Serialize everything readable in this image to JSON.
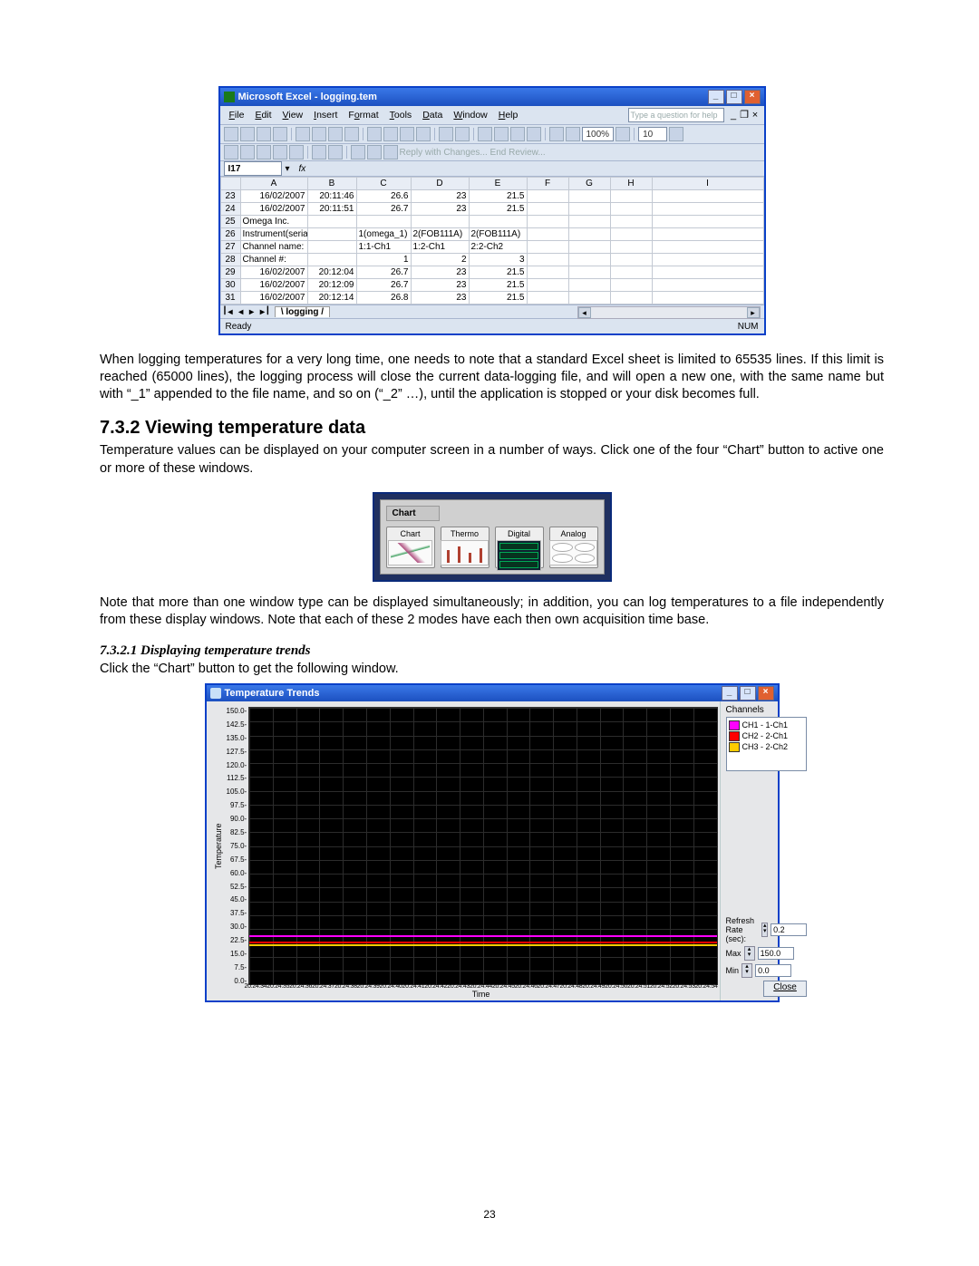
{
  "excel": {
    "title": "Microsoft Excel - logging.tem",
    "menus": [
      "File",
      "Edit",
      "View",
      "Insert",
      "Format",
      "Tools",
      "Data",
      "Window",
      "Help"
    ],
    "question_placeholder": "Type a question for help",
    "zoom": "100%",
    "font_size": "10",
    "toolbar2_text": "Reply with Changes...  End Review...",
    "namebox": "I17",
    "fx": "fx",
    "cols": [
      "A",
      "B",
      "C",
      "D",
      "E",
      "F",
      "G",
      "H",
      "I"
    ],
    "rows": [
      {
        "n": "23",
        "cells": [
          "16/02/2007",
          "20:11:46",
          "26.6",
          "23",
          "21.5",
          "",
          "",
          "",
          ""
        ],
        "align": [
          "r",
          "r",
          "r",
          "r",
          "r",
          "",
          "",
          "",
          ""
        ]
      },
      {
        "n": "24",
        "cells": [
          "16/02/2007",
          "20:11:51",
          "26.7",
          "23",
          "21.5",
          "",
          "",
          "",
          ""
        ],
        "align": [
          "r",
          "r",
          "r",
          "r",
          "r",
          "",
          "",
          "",
          ""
        ]
      },
      {
        "n": "25",
        "cells": [
          "Omega Inc.",
          "",
          "",
          "",
          "",
          "",
          "",
          "",
          ""
        ],
        "align": [
          "l",
          "",
          "",
          "",
          "",
          "",
          "",
          "",
          ""
        ]
      },
      {
        "n": "26",
        "cells": [
          "Instrument(serial):",
          "",
          "1(omega_1)",
          "2(FOB111A)",
          "2(FOB111A)",
          "",
          "",
          "",
          ""
        ],
        "align": [
          "l",
          "",
          "l",
          "l",
          "l",
          "",
          "",
          "",
          ""
        ]
      },
      {
        "n": "27",
        "cells": [
          "Channel name:",
          "",
          "1:1-Ch1",
          "1:2-Ch1",
          "2:2-Ch2",
          "",
          "",
          "",
          ""
        ],
        "align": [
          "l",
          "",
          "l",
          "l",
          "l",
          "",
          "",
          "",
          ""
        ]
      },
      {
        "n": "28",
        "cells": [
          "Channel #:",
          "",
          "1",
          "2",
          "3",
          "",
          "",
          "",
          ""
        ],
        "align": [
          "l",
          "",
          "r",
          "r",
          "r",
          "",
          "",
          "",
          ""
        ]
      },
      {
        "n": "29",
        "cells": [
          "16/02/2007",
          "20:12:04",
          "26.7",
          "23",
          "21.5",
          "",
          "",
          "",
          ""
        ],
        "align": [
          "r",
          "r",
          "r",
          "r",
          "r",
          "",
          "",
          "",
          ""
        ]
      },
      {
        "n": "30",
        "cells": [
          "16/02/2007",
          "20:12:09",
          "26.7",
          "23",
          "21.5",
          "",
          "",
          "",
          ""
        ],
        "align": [
          "r",
          "r",
          "r",
          "r",
          "r",
          "",
          "",
          "",
          ""
        ]
      },
      {
        "n": "31",
        "cells": [
          "16/02/2007",
          "20:12:14",
          "26.8",
          "23",
          "21.5",
          "",
          "",
          "",
          ""
        ],
        "align": [
          "r",
          "r",
          "r",
          "r",
          "r",
          "",
          "",
          "",
          ""
        ]
      }
    ],
    "sheet_tab": "logging",
    "status_ready": "Ready",
    "status_num": "NUM"
  },
  "text": {
    "p1": "When logging temperatures for a very long time, one needs to note that a standard Excel sheet is limited to 65535 lines. If this limit is reached (65000 lines), the logging process will close the current data-logging file, and will open a new one, with the same name but with “_1” appended to the file name, and so on (“_2” …), until the application is stopped or your disk becomes full.",
    "h732": "7.3.2   Viewing temperature data",
    "p2": "Temperature values can be displayed on your computer screen in a number of ways. Click one of the four “Chart” button to active one or more of these windows.",
    "p3": "Note that more than one window type can be displayed simultaneously; in addition, you can log temperatures to a file independently from these display windows. Note that each of these 2 modes have each then own acquisition time base.",
    "h7321": "7.3.2.1    Displaying temperature trends",
    "p4": "Click the “Chart” button to get the following window.",
    "page_no": "23"
  },
  "chartbtns": {
    "group": "Chart",
    "buttons": [
      "Chart",
      "Thermo",
      "Digital",
      "Analog"
    ]
  },
  "trend": {
    "title": "Temperature Trends",
    "ylabel": "Temperature",
    "xlabel": "Time",
    "channels_hdr": "Channels",
    "legend": [
      {
        "label": "CH1 - 1-Ch1",
        "color": "#ff00ff"
      },
      {
        "label": "CH2 - 2-Ch1",
        "color": "#ff0000"
      },
      {
        "label": "CH3 - 2-Ch2",
        "color": "#ffcc00"
      }
    ],
    "refresh_label": "Refresh Rate (sec):",
    "refresh_val": "0.2",
    "max_label": "Max",
    "max_val": "150.0",
    "min_label": "Min",
    "min_val": "0.0",
    "close": "Close"
  },
  "chart_data": {
    "type": "line",
    "title": "Temperature Trends",
    "xlabel": "Time",
    "ylabel": "Temperature",
    "ylim": [
      0,
      150
    ],
    "yticks": [
      150.0,
      142.5,
      135.0,
      127.5,
      120.0,
      112.5,
      105.0,
      97.5,
      90.0,
      82.5,
      75.0,
      67.5,
      60.0,
      52.5,
      45.0,
      37.5,
      30.0,
      22.5,
      15.0,
      7.5,
      0.0
    ],
    "xticks": [
      "20:24:34",
      "20:24:35",
      "20:24:36",
      "20:24:37",
      "20:24:38",
      "20:24:39",
      "20:24:40",
      "20:24:41",
      "20:24:42",
      "20:24:43",
      "20:24:44",
      "20:24:45",
      "20:24:46",
      "20:24:47",
      "20:24:48",
      "20:24:49",
      "20:24:50",
      "20:24:51",
      "20:24:52",
      "20:24:53",
      "20:24:54"
    ],
    "series": [
      {
        "name": "CH1 - 1-Ch1",
        "color": "#ff00ff",
        "approx_value": 26.5
      },
      {
        "name": "CH2 - 2-Ch1",
        "color": "#ff0000",
        "approx_value": 23.0
      },
      {
        "name": "CH3 - 2-Ch2",
        "color": "#ffcc00",
        "approx_value": 21.5
      }
    ]
  }
}
